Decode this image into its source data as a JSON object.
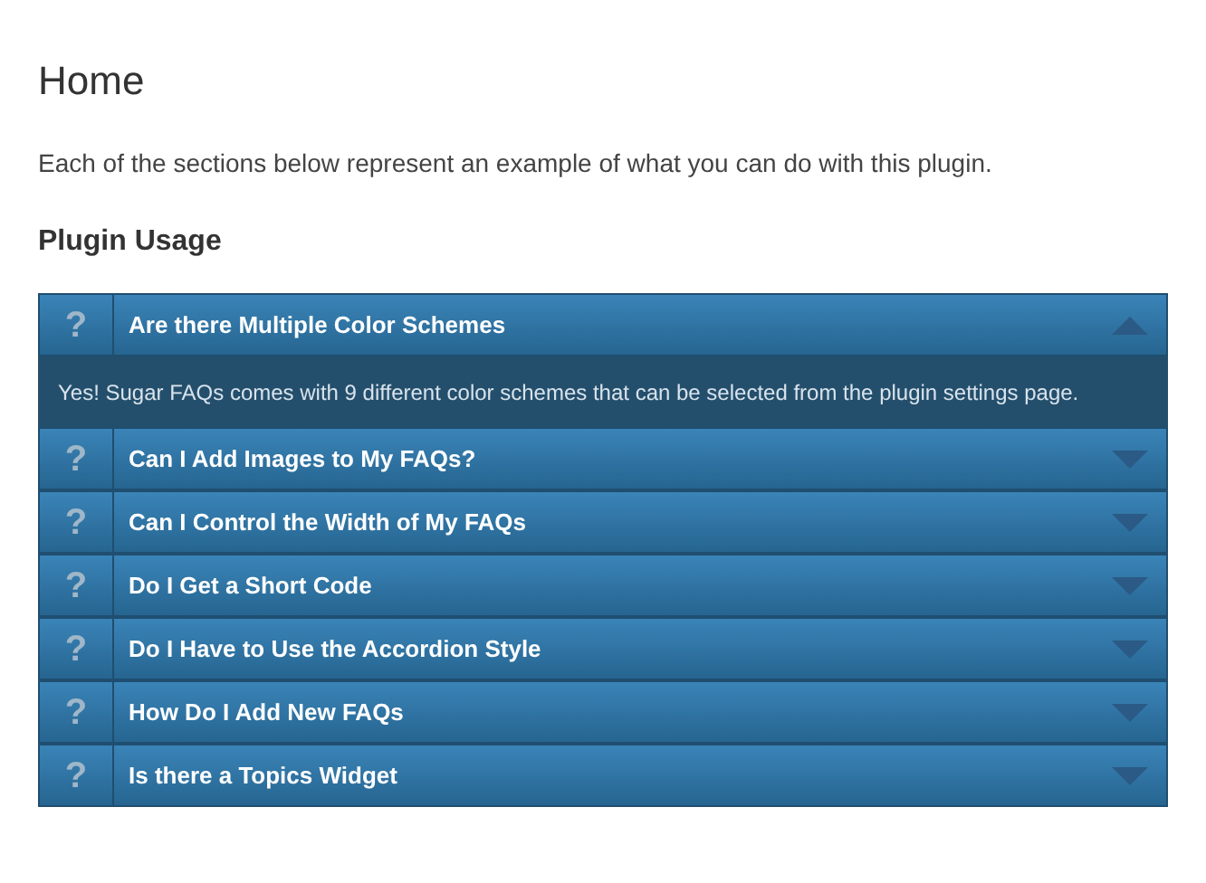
{
  "title": "Home",
  "intro": "Each of the sections below represent an example of what you can do with this plugin.",
  "section_title": "Plugin Usage",
  "faqs": [
    {
      "mark": "?",
      "question": "Are there Multiple Color Schemes",
      "expanded": true,
      "answer": "Yes! Sugar FAQs comes with 9 different color schemes that can be selected from the plugin settings page."
    },
    {
      "mark": "?",
      "question": "Can I Add Images to My FAQs?",
      "expanded": false
    },
    {
      "mark": "?",
      "question": "Can I Control the Width of My FAQs",
      "expanded": false
    },
    {
      "mark": "?",
      "question": "Do I Get a Short Code",
      "expanded": false
    },
    {
      "mark": "?",
      "question": "Do I Have to Use the Accordion Style",
      "expanded": false
    },
    {
      "mark": "?",
      "question": "How Do I Add New FAQs",
      "expanded": false
    },
    {
      "mark": "?",
      "question": "Is there a Topics Widget",
      "expanded": false
    }
  ]
}
